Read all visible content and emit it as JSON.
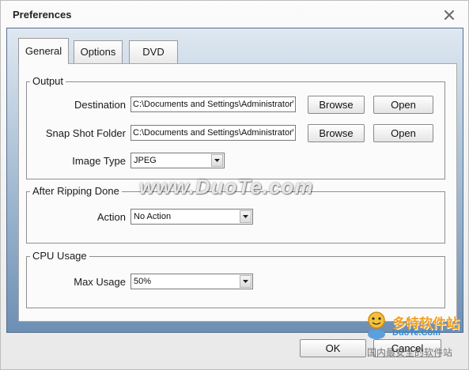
{
  "window": {
    "title": "Preferences"
  },
  "tabs": [
    "General",
    "Options",
    "DVD"
  ],
  "output": {
    "title": "Output",
    "destination_label": "Destination",
    "destination_value": "C:\\Documents and Settings\\Administrator\\M",
    "snapshot_label": "Snap Shot Folder",
    "snapshot_value": "C:\\Documents and Settings\\Administrator\\M",
    "image_type_label": "Image Type",
    "image_type_value": "JPEG",
    "browse_label": "Browse",
    "open_label": "Open"
  },
  "after_ripping": {
    "title": "After Ripping Done",
    "action_label": "Action",
    "action_value": "No Action"
  },
  "cpu": {
    "title": "CPU Usage",
    "max_label": "Max Usage",
    "max_value": "50%"
  },
  "footer": {
    "ok_label": "OK",
    "cancel_label": "Cancel"
  },
  "watermark": "www.DuoTe.com",
  "logo": {
    "line1": "多特软件站",
    "line2": "DuoTe.Com",
    "line3": "国内最安全的软件站"
  },
  "icons": {
    "close": "close-icon",
    "dropdown": "chevron-down-icon",
    "logo": "duote-logo-icon"
  },
  "colors": {
    "frame_top": "#dfe8f1",
    "frame_bottom": "#6d8fb4",
    "panel": "#fbfbfb"
  }
}
